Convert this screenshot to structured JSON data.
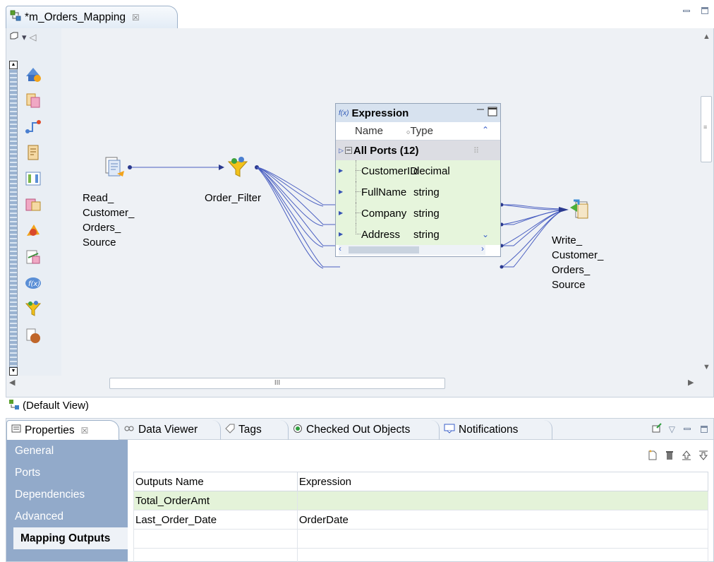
{
  "editor": {
    "tab_title": "*m_Orders_Mapping",
    "tab_close": "☒",
    "default_view": "(Default View)",
    "scroll_grip": "III"
  },
  "palette": {
    "icons": [
      "source-icon",
      "target-icon",
      "joiner-icon",
      "lookup-icon",
      "router-icon",
      "aggregator-icon",
      "sorter-icon",
      "union-icon",
      "expression-icon",
      "filter-icon",
      "normalizer-icon"
    ]
  },
  "nodes": {
    "source": {
      "label_lines": [
        "Read_",
        "Customer_",
        "Orders_",
        "Source"
      ]
    },
    "filter": {
      "label": "Order_Filter"
    },
    "target": {
      "label_lines": [
        "Write_",
        "Customer_",
        "Orders_",
        "Source"
      ]
    }
  },
  "expression": {
    "title": "Expression",
    "title_prefix": "f(x)",
    "col_name": "Name",
    "col_type": "Type",
    "group_label": "All Ports (12)",
    "ports": [
      {
        "name": "CustomerID",
        "type": "decimal"
      },
      {
        "name": "FullName",
        "type": "string"
      },
      {
        "name": "Company",
        "type": "string"
      },
      {
        "name": "Address",
        "type": "string"
      }
    ]
  },
  "properties": {
    "tabs": [
      {
        "label": "Properties",
        "icon": "properties-icon",
        "active": true
      },
      {
        "label": "Data Viewer",
        "icon": "data-viewer-icon",
        "active": false
      },
      {
        "label": "Tags",
        "icon": "tag-icon",
        "active": false
      },
      {
        "label": "Checked Out Objects",
        "icon": "checked-out-icon",
        "active": false
      },
      {
        "label": "Notifications",
        "icon": "notifications-icon",
        "active": false
      }
    ],
    "nav": [
      {
        "label": "General",
        "active": false
      },
      {
        "label": "Ports",
        "active": false
      },
      {
        "label": "Dependencies",
        "active": false
      },
      {
        "label": "Advanced",
        "active": false
      },
      {
        "label": "Mapping Outputs",
        "active": true
      }
    ],
    "table": {
      "headers": [
        "Outputs Name",
        "Expression"
      ],
      "rows": [
        {
          "name": "Total_OrderAmt",
          "expression": "",
          "selected": true
        },
        {
          "name": "Last_Order_Date",
          "expression": "OrderDate",
          "selected": false
        },
        {
          "name": "",
          "expression": "",
          "selected": false
        },
        {
          "name": "",
          "expression": "",
          "selected": false
        }
      ]
    },
    "toolbar_icons": [
      "new-output-icon",
      "delete-icon",
      "move-up-icon",
      "move-down-icon"
    ]
  },
  "colors": {
    "canvas_bg": "#eef1f5",
    "port_row_bg": "#e6f5dc",
    "nav_bg": "#92aaca",
    "wire": "#4a5fc1"
  }
}
